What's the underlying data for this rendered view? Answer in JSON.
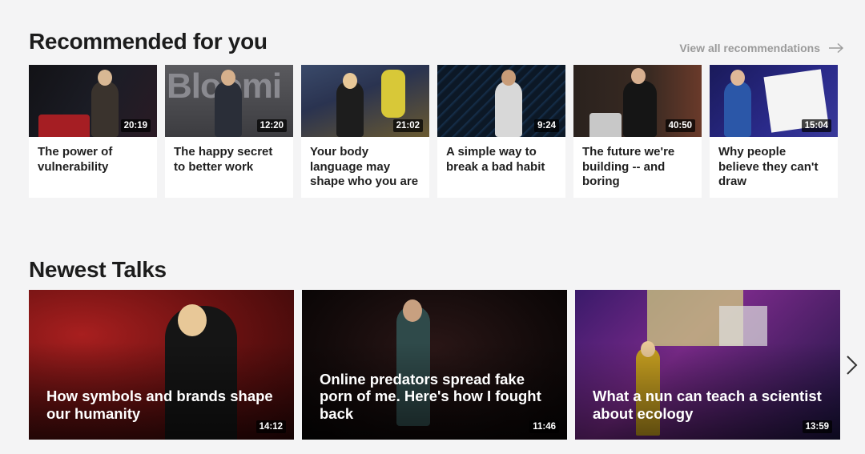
{
  "recommended": {
    "title": "Recommended for you",
    "view_all": "View all recommendations",
    "talks": [
      {
        "title": "The power of vulnerability",
        "duration": "20:19",
        "bg": "#1b1b20",
        "accent": "#9e1c22",
        "figure": "#3a332d"
      },
      {
        "title": "The happy secret to better work",
        "duration": "12:20",
        "bg": "#4b4b4f",
        "accent": "#7a7a80",
        "figure": "#2a2e38"
      },
      {
        "title": "Your body language may shape who you are",
        "duration": "21:02",
        "bg": "#2f3d5c",
        "accent": "#c8a04a",
        "figure": "#1d1d1d"
      },
      {
        "title": "A simple way to break a bad habit",
        "duration": "9:24",
        "bg": "#0f1b2a",
        "accent": "#1c4a7a",
        "figure": "#dcdcdc"
      },
      {
        "title": "The future we're building -- and boring",
        "duration": "40:50",
        "bg": "#2a1e1a",
        "accent": "#6b3a2a",
        "figure": "#1a1a1a"
      },
      {
        "title": "Why people believe they can't draw",
        "duration": "15:04",
        "bg": "#24246a",
        "accent": "#f2f2f2",
        "figure": "#2b57a8"
      }
    ]
  },
  "newest": {
    "title": "Newest Talks",
    "talks": [
      {
        "title": "How symbols and brands shape our humanity",
        "duration": "14:12",
        "bg": "#5a1010",
        "accent": "#b02020"
      },
      {
        "title": "Online predators spread fake porn of me. Here's how I fought back",
        "duration": "11:46",
        "bg": "#0e0a0a",
        "accent": "#3a1a1a"
      },
      {
        "title": "What a nun can teach a scientist about ecology",
        "duration": "13:59",
        "bg": "#1a1440",
        "accent": "#8a2a9a"
      }
    ]
  }
}
